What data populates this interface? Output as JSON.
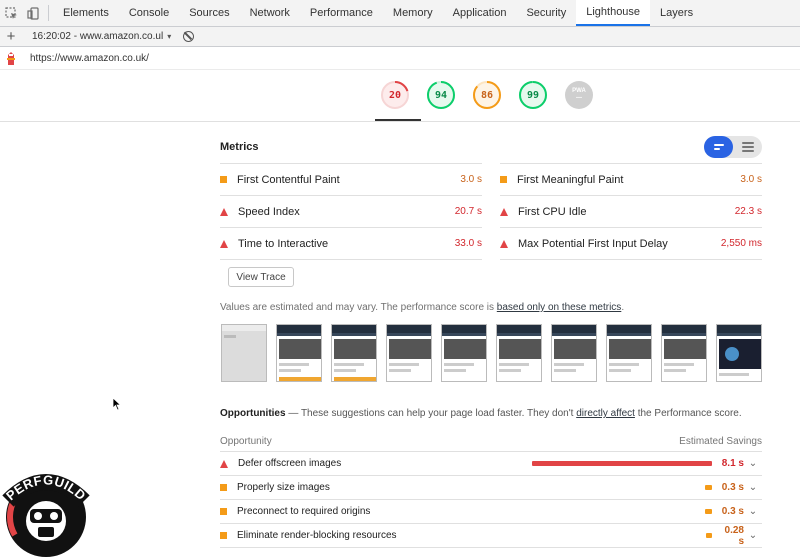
{
  "devtools": {
    "tabs": [
      "Elements",
      "Console",
      "Sources",
      "Network",
      "Performance",
      "Memory",
      "Application",
      "Security",
      "Lighthouse",
      "Layers"
    ],
    "active_tab": "Lighthouse"
  },
  "toolbar": {
    "report_label": "16:20:02 - www.amazon.co.ul",
    "caret": "▾"
  },
  "url": "https://www.amazon.co.uk/",
  "gauges": [
    {
      "score": "20",
      "color": "#e14446",
      "fraction": 0.2
    },
    {
      "score": "94",
      "color": "#0cce6b",
      "fraction": 0.94
    },
    {
      "score": "86",
      "color": "#f49b18",
      "fraction": 0.86
    },
    {
      "score": "99",
      "color": "#0cce6b",
      "fraction": 0.99
    },
    {
      "score": "—",
      "label": "PWA",
      "color": "#bdbdbd",
      "fraction": 0
    }
  ],
  "metrics": {
    "title": "Metrics",
    "items": [
      {
        "name": "First Contentful Paint",
        "value": "3.0 s",
        "status": "average"
      },
      {
        "name": "First Meaningful Paint",
        "value": "3.0 s",
        "status": "average"
      },
      {
        "name": "Speed Index",
        "value": "20.7 s",
        "status": "fail"
      },
      {
        "name": "First CPU Idle",
        "value": "22.3 s",
        "status": "fail"
      },
      {
        "name": "Time to Interactive",
        "value": "33.0 s",
        "status": "fail"
      },
      {
        "name": "Max Potential First Input Delay",
        "value": "2,550 ms",
        "status": "fail"
      }
    ],
    "view_trace_label": "View Trace",
    "note_prefix": "Values are estimated and may vary. The performance score is ",
    "note_link": "based only on these metrics",
    "note_suffix": "."
  },
  "filmstrip_frames": 10,
  "opportunities": {
    "title": "Opportunities",
    "dash": " — ",
    "desc_prefix": "These suggestions can help your page load faster. They don't ",
    "desc_link": "directly affect",
    "desc_suffix": " the Performance score.",
    "col_opportunity": "Opportunity",
    "col_savings": "Estimated Savings",
    "items": [
      {
        "name": "Defer offscreen images",
        "savings": "8.1 s",
        "status": "fail",
        "fraction": 1.0
      },
      {
        "name": "Properly size images",
        "savings": "0.3 s",
        "status": "average",
        "fraction": 0.04
      },
      {
        "name": "Preconnect to required origins",
        "savings": "0.3 s",
        "status": "average",
        "fraction": 0.04
      },
      {
        "name": "Eliminate render-blocking resources",
        "savings": "0.28 s",
        "status": "average",
        "fraction": 0.035
      }
    ]
  },
  "logo": {
    "text": "PERFGUILD"
  }
}
